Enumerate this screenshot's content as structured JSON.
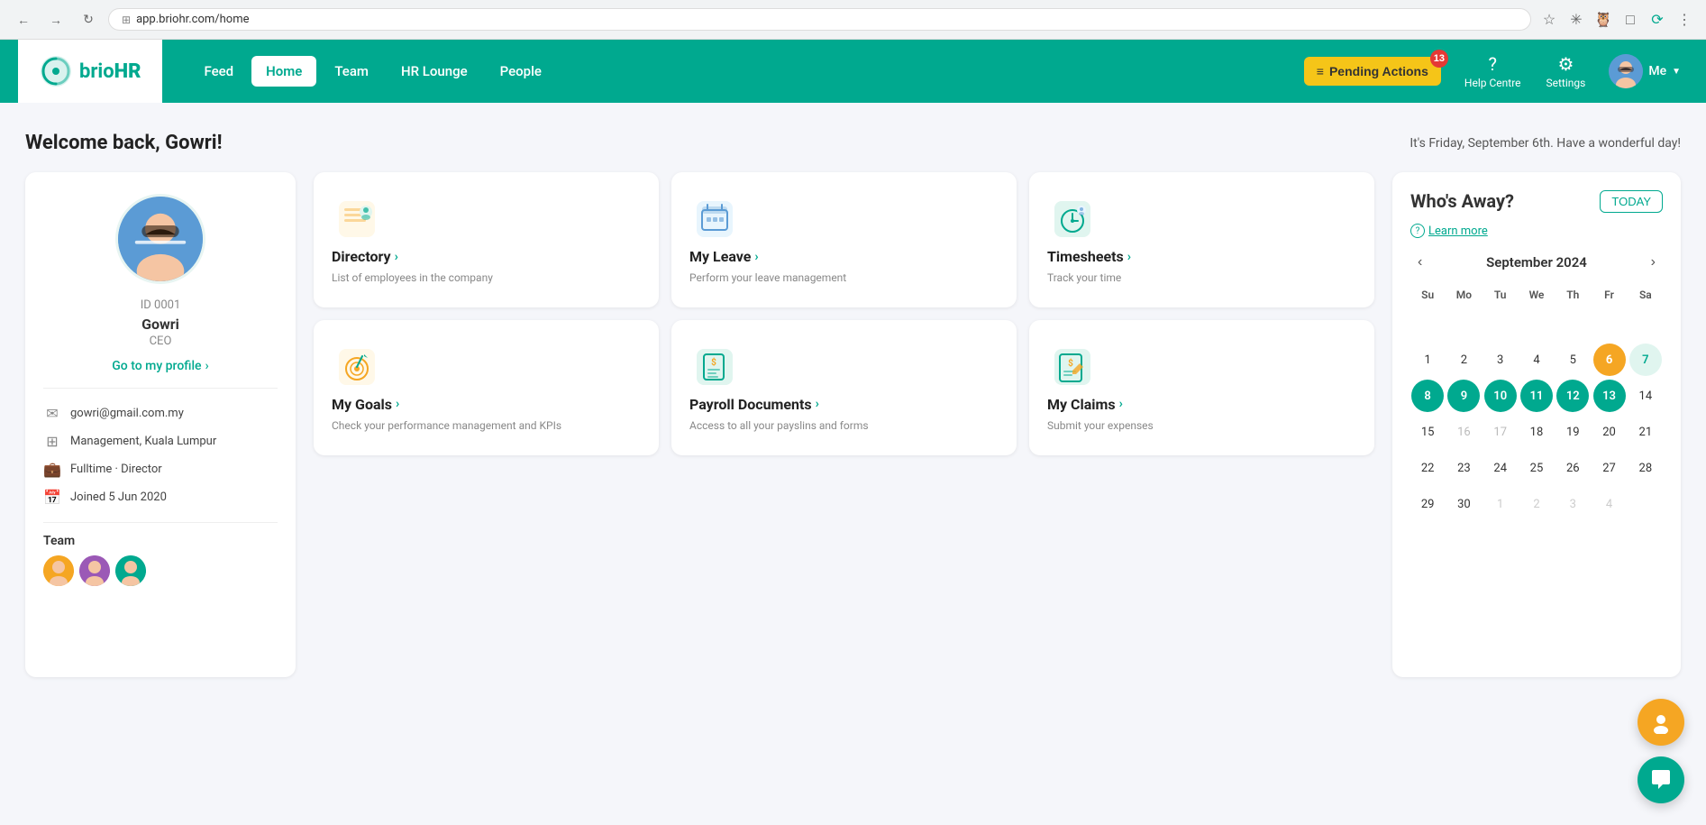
{
  "browser": {
    "url": "app.briohr.com/home",
    "back_disabled": false,
    "forward_disabled": false
  },
  "nav": {
    "logo_text_brio": "brio",
    "logo_text_hr": "HR",
    "links": [
      {
        "id": "feed",
        "label": "Feed",
        "active": false
      },
      {
        "id": "home",
        "label": "Home",
        "active": true
      },
      {
        "id": "team",
        "label": "Team",
        "active": false
      },
      {
        "id": "hr-lounge",
        "label": "HR Lounge",
        "active": false
      },
      {
        "id": "people",
        "label": "People",
        "active": false
      }
    ],
    "pending_actions_label": "Pending Actions",
    "pending_actions_count": "13",
    "help_centre_label": "Help Centre",
    "settings_label": "Settings",
    "user_label": "Me"
  },
  "welcome": {
    "title": "Welcome back, Gowri!",
    "date_message": "It's Friday, September 6th. Have a wonderful day!"
  },
  "profile": {
    "id": "ID 0001",
    "name": "Gowri",
    "role": "CEO",
    "profile_link": "Go to my profile",
    "email": "gowri@gmail.com.my",
    "department": "Management, Kuala Lumpur",
    "employment": "Fulltime · Director",
    "joined": "Joined 5 Jun 2020",
    "team_section": "Team"
  },
  "quick_access": [
    {
      "id": "directory",
      "title": "Directory",
      "desc": "List of employees in the company",
      "icon_type": "directory"
    },
    {
      "id": "my-leave",
      "title": "My Leave",
      "desc": "Perform your leave management",
      "icon_type": "leave"
    },
    {
      "id": "timesheets",
      "title": "Timesheets",
      "desc": "Track your time",
      "icon_type": "timesheets"
    },
    {
      "id": "my-goals",
      "title": "My Goals",
      "desc": "Check your performance management and KPIs",
      "icon_type": "goals"
    },
    {
      "id": "payroll-documents",
      "title": "Payroll Documents",
      "desc": "Access to all your payslins and forms",
      "icon_type": "payroll"
    },
    {
      "id": "my-claims",
      "title": "My Claims",
      "desc": "Submit your expenses",
      "icon_type": "claims"
    }
  ],
  "calendar": {
    "whos_away_title": "Who's Away?",
    "today_btn": "TODAY",
    "learn_more": "Learn more",
    "month": "September",
    "year": "2024",
    "day_headers": [
      "Su",
      "Mo",
      "Tu",
      "We",
      "Th",
      "Fr",
      "Sa"
    ],
    "days": [
      {
        "day": "",
        "type": "empty"
      },
      {
        "day": "",
        "type": "empty"
      },
      {
        "day": "",
        "type": "empty"
      },
      {
        "day": "",
        "type": "empty"
      },
      {
        "day": "",
        "type": "empty"
      },
      {
        "day": "",
        "type": "empty"
      },
      {
        "day": "",
        "type": "empty"
      },
      {
        "day": "1",
        "type": "normal"
      },
      {
        "day": "2",
        "type": "normal"
      },
      {
        "day": "3",
        "type": "normal"
      },
      {
        "day": "4",
        "type": "normal"
      },
      {
        "day": "5",
        "type": "normal"
      },
      {
        "day": "6",
        "type": "today"
      },
      {
        "day": "7",
        "type": "sat"
      },
      {
        "day": "8",
        "type": "highlighted"
      },
      {
        "day": "9",
        "type": "highlighted"
      },
      {
        "day": "10",
        "type": "highlighted"
      },
      {
        "day": "11",
        "type": "highlighted"
      },
      {
        "day": "12",
        "type": "highlighted"
      },
      {
        "day": "13",
        "type": "highlighted"
      },
      {
        "day": "14",
        "type": "normal"
      },
      {
        "day": "15",
        "type": "normal"
      },
      {
        "day": "16",
        "type": "empty"
      },
      {
        "day": "17",
        "type": "empty"
      },
      {
        "day": "18",
        "type": "normal"
      },
      {
        "day": "19",
        "type": "normal"
      },
      {
        "day": "20",
        "type": "normal"
      },
      {
        "day": "21",
        "type": "normal"
      },
      {
        "day": "22",
        "type": "normal"
      },
      {
        "day": "23",
        "type": "normal"
      },
      {
        "day": "24",
        "type": "normal"
      },
      {
        "day": "25",
        "type": "normal"
      },
      {
        "day": "26",
        "type": "normal"
      },
      {
        "day": "27",
        "type": "normal"
      },
      {
        "day": "28",
        "type": "normal"
      },
      {
        "day": "29",
        "type": "normal"
      },
      {
        "day": "30",
        "type": "normal"
      },
      {
        "day": "1",
        "type": "other-month"
      },
      {
        "day": "2",
        "type": "other-month"
      },
      {
        "day": "3",
        "type": "other-month"
      },
      {
        "day": "4",
        "type": "other-month"
      }
    ]
  }
}
